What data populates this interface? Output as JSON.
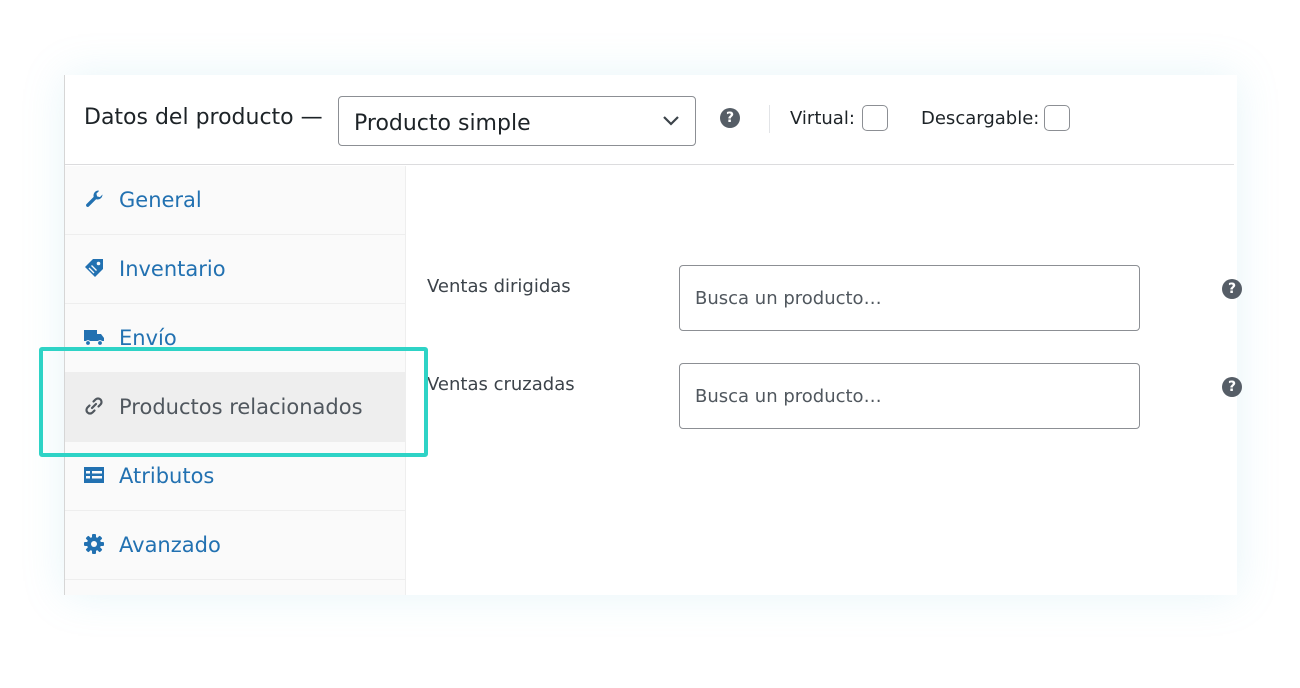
{
  "header": {
    "title": "Datos del producto —",
    "product_type": "Producto simple",
    "virtual_label": "Virtual:",
    "downloadable_label": "Descargable:",
    "help_glyph": "?"
  },
  "tabs": [
    {
      "label": "General",
      "icon": "wrench-icon",
      "active": false
    },
    {
      "label": "Inventario",
      "icon": "tag-icon",
      "active": false
    },
    {
      "label": "Envío",
      "icon": "truck-icon",
      "active": false
    },
    {
      "label": "Productos relacionados",
      "icon": "link-icon",
      "active": true
    },
    {
      "label": "Atributos",
      "icon": "list-table-icon",
      "active": false
    },
    {
      "label": "Avanzado",
      "icon": "gear-icon",
      "active": false
    }
  ],
  "fields": {
    "upsells": {
      "label": "Ventas dirigidas",
      "placeholder": "Busca un producto…"
    },
    "crosssells": {
      "label": "Ventas cruzadas",
      "placeholder": "Busca un producto…"
    }
  },
  "colors": {
    "link": "#2271b1",
    "active_tab_bg": "#eeeeee",
    "highlight": "#2ed3c6",
    "help_icon": "#555d66"
  }
}
